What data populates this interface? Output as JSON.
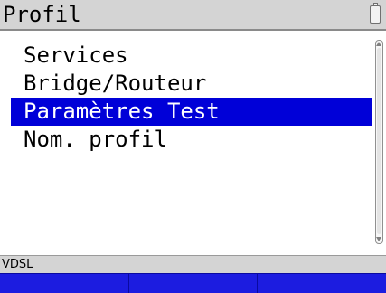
{
  "header": {
    "title": "Profil",
    "battery_icon": "battery-icon"
  },
  "menu": {
    "items": [
      {
        "label": "Services",
        "selected": false
      },
      {
        "label": "Bridge/Routeur",
        "selected": false
      },
      {
        "label": "Paramètres Test",
        "selected": true
      },
      {
        "label": "Nom. profil",
        "selected": false
      }
    ]
  },
  "status": {
    "text": "VDSL"
  },
  "softkeys": [
    {
      "label": ""
    },
    {
      "label": ""
    },
    {
      "label": ""
    }
  ],
  "colors": {
    "selection": "#0000d8",
    "softkey_bar": "#1c1ce0",
    "title_bar": "#d4d4d4"
  }
}
